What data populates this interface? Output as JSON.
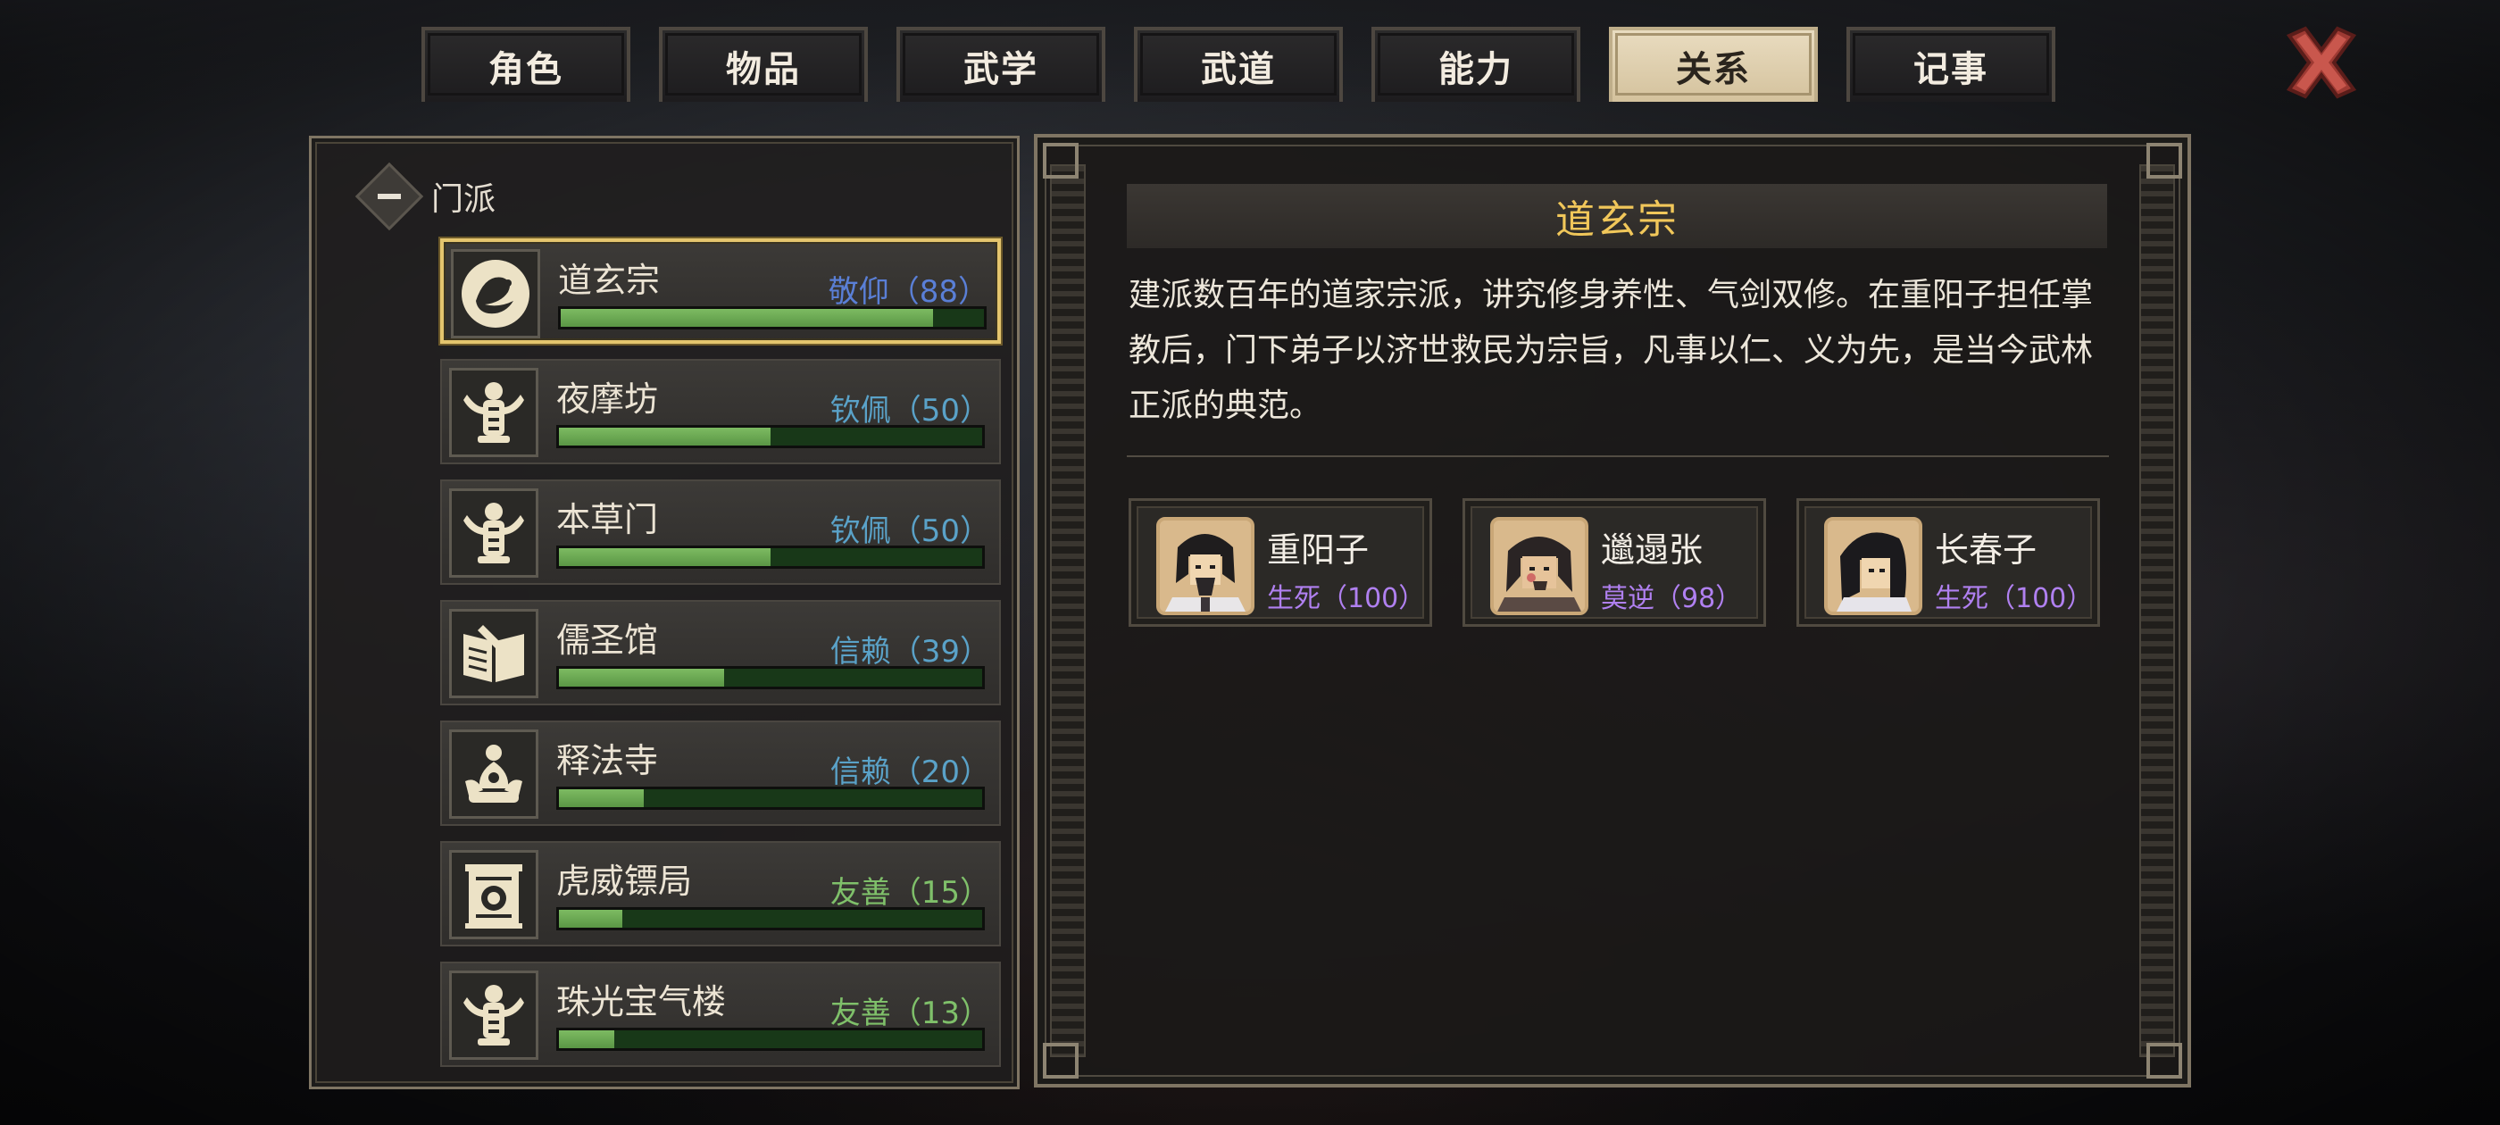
{
  "tabs": [
    {
      "label": "角色",
      "active": false
    },
    {
      "label": "物品",
      "active": false
    },
    {
      "label": "武学",
      "active": false
    },
    {
      "label": "武道",
      "active": false
    },
    {
      "label": "能力",
      "active": false
    },
    {
      "label": "关系",
      "active": true
    },
    {
      "label": "记事",
      "active": false
    }
  ],
  "close_icon": "close-x-icon",
  "group": {
    "label": "门派",
    "icon": "collapse-minus-icon"
  },
  "factions": [
    {
      "name": "道玄宗",
      "relation": "敬仰（88）",
      "progress": 0.88,
      "relation_color": "#5a7fd6",
      "emblem": "crane-emblem-icon",
      "selected": true
    },
    {
      "name": "夜摩坊",
      "relation": "钦佩（50）",
      "progress": 0.5,
      "relation_color": "#5aa2c8",
      "emblem": "totem-emblem-icon",
      "selected": false
    },
    {
      "name": "本草门",
      "relation": "钦佩（50）",
      "progress": 0.5,
      "relation_color": "#5aa2c8",
      "emblem": "totem-emblem-icon",
      "selected": false
    },
    {
      "name": "儒圣馆",
      "relation": "信赖（39）",
      "progress": 0.39,
      "relation_color": "#5aa2c8",
      "emblem": "book-emblem-icon",
      "selected": false
    },
    {
      "name": "释法寺",
      "relation": "信赖（20）",
      "progress": 0.2,
      "relation_color": "#5aa2c8",
      "emblem": "lotus-emblem-icon",
      "selected": false
    },
    {
      "name": "虎威镖局",
      "relation": "友善（15）",
      "progress": 0.15,
      "relation_color": "#7fc06a",
      "emblem": "banner-emblem-icon",
      "selected": false
    },
    {
      "name": "珠光宝气楼",
      "relation": "友善（13）",
      "progress": 0.13,
      "relation_color": "#7fc06a",
      "emblem": "totem-emblem-icon",
      "selected": false
    }
  ],
  "detail": {
    "title": "道玄宗",
    "description": "建派数百年的道家宗派，讲究修身养性、气剑双修。在重阳子担任掌教后，门下弟子以济世救民为宗旨，凡事以仁、义为先，是当今武林正派的典范。",
    "members": [
      {
        "name": "重阳子",
        "relation": "生死（100）",
        "portrait": "elder-portrait-icon"
      },
      {
        "name": "邋遢张",
        "relation": "莫逆（98）",
        "portrait": "beggar-portrait-icon"
      },
      {
        "name": "长春子",
        "relation": "生死（100）",
        "portrait": "swordsman-portrait-icon"
      }
    ]
  }
}
